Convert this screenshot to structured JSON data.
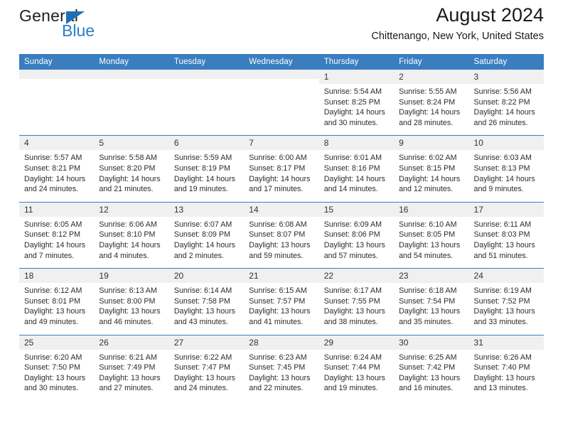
{
  "brand": {
    "name_top": "General",
    "name_bottom": "Blue",
    "triangle_color": "#1f6fb5",
    "blue_text_color": "#2a7fc9"
  },
  "header": {
    "title": "August 2024",
    "location": "Chittenango, New York, United States"
  },
  "theme": {
    "header_blue": "#3a7ebf",
    "daynum_band": "#f0f0f0",
    "text": "#2b2b2b"
  },
  "weekdays": [
    "Sunday",
    "Monday",
    "Tuesday",
    "Wednesday",
    "Thursday",
    "Friday",
    "Saturday"
  ],
  "weeks": [
    [
      {
        "day": "",
        "empty": true,
        "sunrise": "",
        "sunset": "",
        "daylight1": "",
        "daylight2": ""
      },
      {
        "day": "",
        "empty": true,
        "sunrise": "",
        "sunset": "",
        "daylight1": "",
        "daylight2": ""
      },
      {
        "day": "",
        "empty": true,
        "sunrise": "",
        "sunset": "",
        "daylight1": "",
        "daylight2": ""
      },
      {
        "day": "",
        "empty": true,
        "sunrise": "",
        "sunset": "",
        "daylight1": "",
        "daylight2": ""
      },
      {
        "day": "1",
        "sunrise": "Sunrise: 5:54 AM",
        "sunset": "Sunset: 8:25 PM",
        "daylight1": "Daylight: 14 hours",
        "daylight2": "and 30 minutes."
      },
      {
        "day": "2",
        "sunrise": "Sunrise: 5:55 AM",
        "sunset": "Sunset: 8:24 PM",
        "daylight1": "Daylight: 14 hours",
        "daylight2": "and 28 minutes."
      },
      {
        "day": "3",
        "sunrise": "Sunrise: 5:56 AM",
        "sunset": "Sunset: 8:22 PM",
        "daylight1": "Daylight: 14 hours",
        "daylight2": "and 26 minutes."
      }
    ],
    [
      {
        "day": "4",
        "sunrise": "Sunrise: 5:57 AM",
        "sunset": "Sunset: 8:21 PM",
        "daylight1": "Daylight: 14 hours",
        "daylight2": "and 24 minutes."
      },
      {
        "day": "5",
        "sunrise": "Sunrise: 5:58 AM",
        "sunset": "Sunset: 8:20 PM",
        "daylight1": "Daylight: 14 hours",
        "daylight2": "and 21 minutes."
      },
      {
        "day": "6",
        "sunrise": "Sunrise: 5:59 AM",
        "sunset": "Sunset: 8:19 PM",
        "daylight1": "Daylight: 14 hours",
        "daylight2": "and 19 minutes."
      },
      {
        "day": "7",
        "sunrise": "Sunrise: 6:00 AM",
        "sunset": "Sunset: 8:17 PM",
        "daylight1": "Daylight: 14 hours",
        "daylight2": "and 17 minutes."
      },
      {
        "day": "8",
        "sunrise": "Sunrise: 6:01 AM",
        "sunset": "Sunset: 8:16 PM",
        "daylight1": "Daylight: 14 hours",
        "daylight2": "and 14 minutes."
      },
      {
        "day": "9",
        "sunrise": "Sunrise: 6:02 AM",
        "sunset": "Sunset: 8:15 PM",
        "daylight1": "Daylight: 14 hours",
        "daylight2": "and 12 minutes."
      },
      {
        "day": "10",
        "sunrise": "Sunrise: 6:03 AM",
        "sunset": "Sunset: 8:13 PM",
        "daylight1": "Daylight: 14 hours",
        "daylight2": "and 9 minutes."
      }
    ],
    [
      {
        "day": "11",
        "sunrise": "Sunrise: 6:05 AM",
        "sunset": "Sunset: 8:12 PM",
        "daylight1": "Daylight: 14 hours",
        "daylight2": "and 7 minutes."
      },
      {
        "day": "12",
        "sunrise": "Sunrise: 6:06 AM",
        "sunset": "Sunset: 8:10 PM",
        "daylight1": "Daylight: 14 hours",
        "daylight2": "and 4 minutes."
      },
      {
        "day": "13",
        "sunrise": "Sunrise: 6:07 AM",
        "sunset": "Sunset: 8:09 PM",
        "daylight1": "Daylight: 14 hours",
        "daylight2": "and 2 minutes."
      },
      {
        "day": "14",
        "sunrise": "Sunrise: 6:08 AM",
        "sunset": "Sunset: 8:07 PM",
        "daylight1": "Daylight: 13 hours",
        "daylight2": "and 59 minutes."
      },
      {
        "day": "15",
        "sunrise": "Sunrise: 6:09 AM",
        "sunset": "Sunset: 8:06 PM",
        "daylight1": "Daylight: 13 hours",
        "daylight2": "and 57 minutes."
      },
      {
        "day": "16",
        "sunrise": "Sunrise: 6:10 AM",
        "sunset": "Sunset: 8:05 PM",
        "daylight1": "Daylight: 13 hours",
        "daylight2": "and 54 minutes."
      },
      {
        "day": "17",
        "sunrise": "Sunrise: 6:11 AM",
        "sunset": "Sunset: 8:03 PM",
        "daylight1": "Daylight: 13 hours",
        "daylight2": "and 51 minutes."
      }
    ],
    [
      {
        "day": "18",
        "sunrise": "Sunrise: 6:12 AM",
        "sunset": "Sunset: 8:01 PM",
        "daylight1": "Daylight: 13 hours",
        "daylight2": "and 49 minutes."
      },
      {
        "day": "19",
        "sunrise": "Sunrise: 6:13 AM",
        "sunset": "Sunset: 8:00 PM",
        "daylight1": "Daylight: 13 hours",
        "daylight2": "and 46 minutes."
      },
      {
        "day": "20",
        "sunrise": "Sunrise: 6:14 AM",
        "sunset": "Sunset: 7:58 PM",
        "daylight1": "Daylight: 13 hours",
        "daylight2": "and 43 minutes."
      },
      {
        "day": "21",
        "sunrise": "Sunrise: 6:15 AM",
        "sunset": "Sunset: 7:57 PM",
        "daylight1": "Daylight: 13 hours",
        "daylight2": "and 41 minutes."
      },
      {
        "day": "22",
        "sunrise": "Sunrise: 6:17 AM",
        "sunset": "Sunset: 7:55 PM",
        "daylight1": "Daylight: 13 hours",
        "daylight2": "and 38 minutes."
      },
      {
        "day": "23",
        "sunrise": "Sunrise: 6:18 AM",
        "sunset": "Sunset: 7:54 PM",
        "daylight1": "Daylight: 13 hours",
        "daylight2": "and 35 minutes."
      },
      {
        "day": "24",
        "sunrise": "Sunrise: 6:19 AM",
        "sunset": "Sunset: 7:52 PM",
        "daylight1": "Daylight: 13 hours",
        "daylight2": "and 33 minutes."
      }
    ],
    [
      {
        "day": "25",
        "sunrise": "Sunrise: 6:20 AM",
        "sunset": "Sunset: 7:50 PM",
        "daylight1": "Daylight: 13 hours",
        "daylight2": "and 30 minutes."
      },
      {
        "day": "26",
        "sunrise": "Sunrise: 6:21 AM",
        "sunset": "Sunset: 7:49 PM",
        "daylight1": "Daylight: 13 hours",
        "daylight2": "and 27 minutes."
      },
      {
        "day": "27",
        "sunrise": "Sunrise: 6:22 AM",
        "sunset": "Sunset: 7:47 PM",
        "daylight1": "Daylight: 13 hours",
        "daylight2": "and 24 minutes."
      },
      {
        "day": "28",
        "sunrise": "Sunrise: 6:23 AM",
        "sunset": "Sunset: 7:45 PM",
        "daylight1": "Daylight: 13 hours",
        "daylight2": "and 22 minutes."
      },
      {
        "day": "29",
        "sunrise": "Sunrise: 6:24 AM",
        "sunset": "Sunset: 7:44 PM",
        "daylight1": "Daylight: 13 hours",
        "daylight2": "and 19 minutes."
      },
      {
        "day": "30",
        "sunrise": "Sunrise: 6:25 AM",
        "sunset": "Sunset: 7:42 PM",
        "daylight1": "Daylight: 13 hours",
        "daylight2": "and 16 minutes."
      },
      {
        "day": "31",
        "sunrise": "Sunrise: 6:26 AM",
        "sunset": "Sunset: 7:40 PM",
        "daylight1": "Daylight: 13 hours",
        "daylight2": "and 13 minutes."
      }
    ]
  ]
}
